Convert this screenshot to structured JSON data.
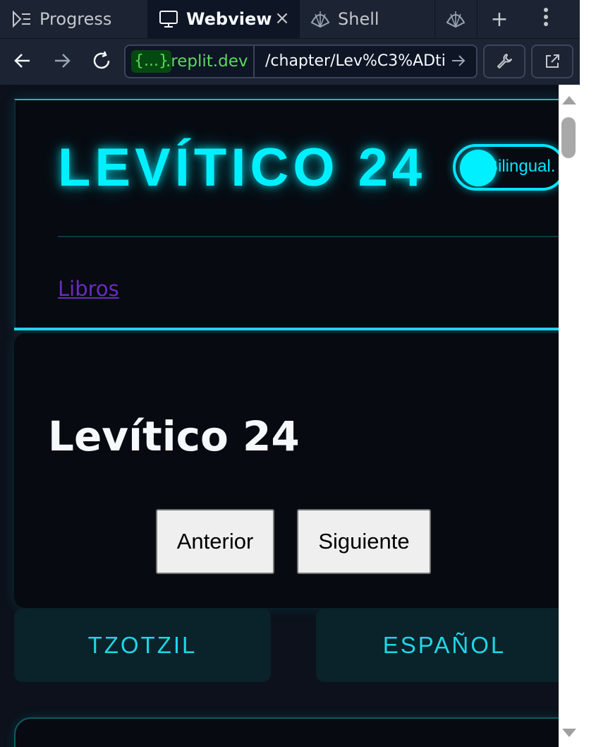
{
  "tabs": [
    {
      "label": "Progress",
      "icon": "progress-icon"
    },
    {
      "label": "Webview",
      "icon": "monitor-icon",
      "active": true
    },
    {
      "label": "Shell",
      "icon": "shell-icon"
    },
    {
      "label": "",
      "icon": "shell-icon"
    }
  ],
  "tabbar": {
    "close_glyph": "×",
    "add_glyph": "+"
  },
  "address": {
    "badge": "{...}",
    "host": ".replit.dev",
    "path": "/chapter/Lev%C3%ADti"
  },
  "site": {
    "title": "LEVÍTICO 24",
    "toggle_label": "Bilingual.",
    "nav_link": "Libros"
  },
  "chapter": {
    "title": "Levítico 24",
    "prev_label": "Anterior",
    "next_label": "Siguiente"
  },
  "languages": {
    "left": "TZOTZIL",
    "right": "ESPAÑOL"
  },
  "colors": {
    "accent": "#00f0ff",
    "bg": "#0c111b",
    "link": "#6a2bbf"
  }
}
